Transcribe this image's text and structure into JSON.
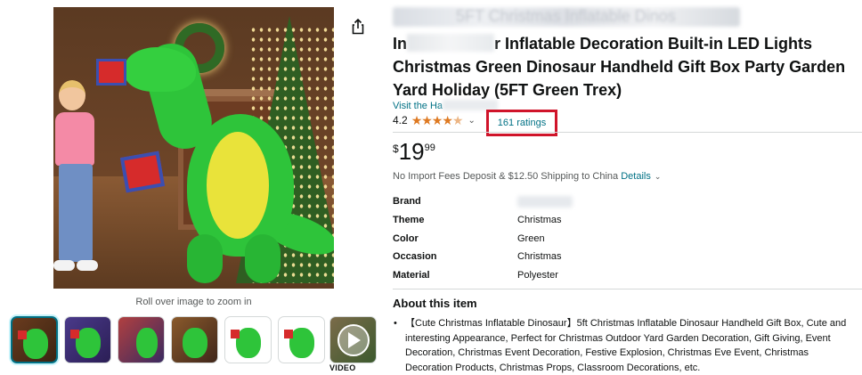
{
  "gallery": {
    "rollover_text": "Roll over image to zoom in",
    "video_label": "VIDEO",
    "thumbnails": [
      "thumb-1",
      "thumb-2",
      "thumb-3",
      "thumb-4",
      "thumb-5",
      "thumb-6"
    ]
  },
  "product": {
    "title_line1_blurred": "5FT Christmas Inflatable Dinos",
    "title_visible": "r Inflatable Decoration Built-in LED Lights Christmas Green Dinosaur Handheld Gift Box Party Garden Yard Holiday (5FT Green Trex)",
    "title_prefix": "In",
    "store_text": "Visit the Ha",
    "rating_value": "4.2",
    "ratings_count": "161 ratings",
    "price_symbol": "$",
    "price_whole": "19",
    "price_fraction": "99",
    "shipping_text": "No Import Fees Deposit & $12.50 Shipping to China",
    "shipping_link": "Details"
  },
  "specs": [
    {
      "key": "Brand",
      "value": ""
    },
    {
      "key": "Theme",
      "value": "Christmas"
    },
    {
      "key": "Color",
      "value": "Green"
    },
    {
      "key": "Occasion",
      "value": "Christmas"
    },
    {
      "key": "Material",
      "value": "Polyester"
    }
  ],
  "about": {
    "heading": "About this item",
    "bullets": [
      "【Cute Christmas Inflatable Dinosaur】5ft Christmas Inflatable Dinosaur Handheld Gift Box, Cute and interesting Appearance, Perfect for Christmas Outdoor Yard Garden Decoration, Gift Giving, Event Decoration, Christmas Event Decoration, Festive Explosion, Christmas Eve Event, Christmas Decoration Products, Christmas Props, Classroom Decorations, etc."
    ]
  },
  "colors": {
    "link": "#007185",
    "star": "#de7921",
    "highlight_box": "#d0142a",
    "text": "#0f1111"
  }
}
